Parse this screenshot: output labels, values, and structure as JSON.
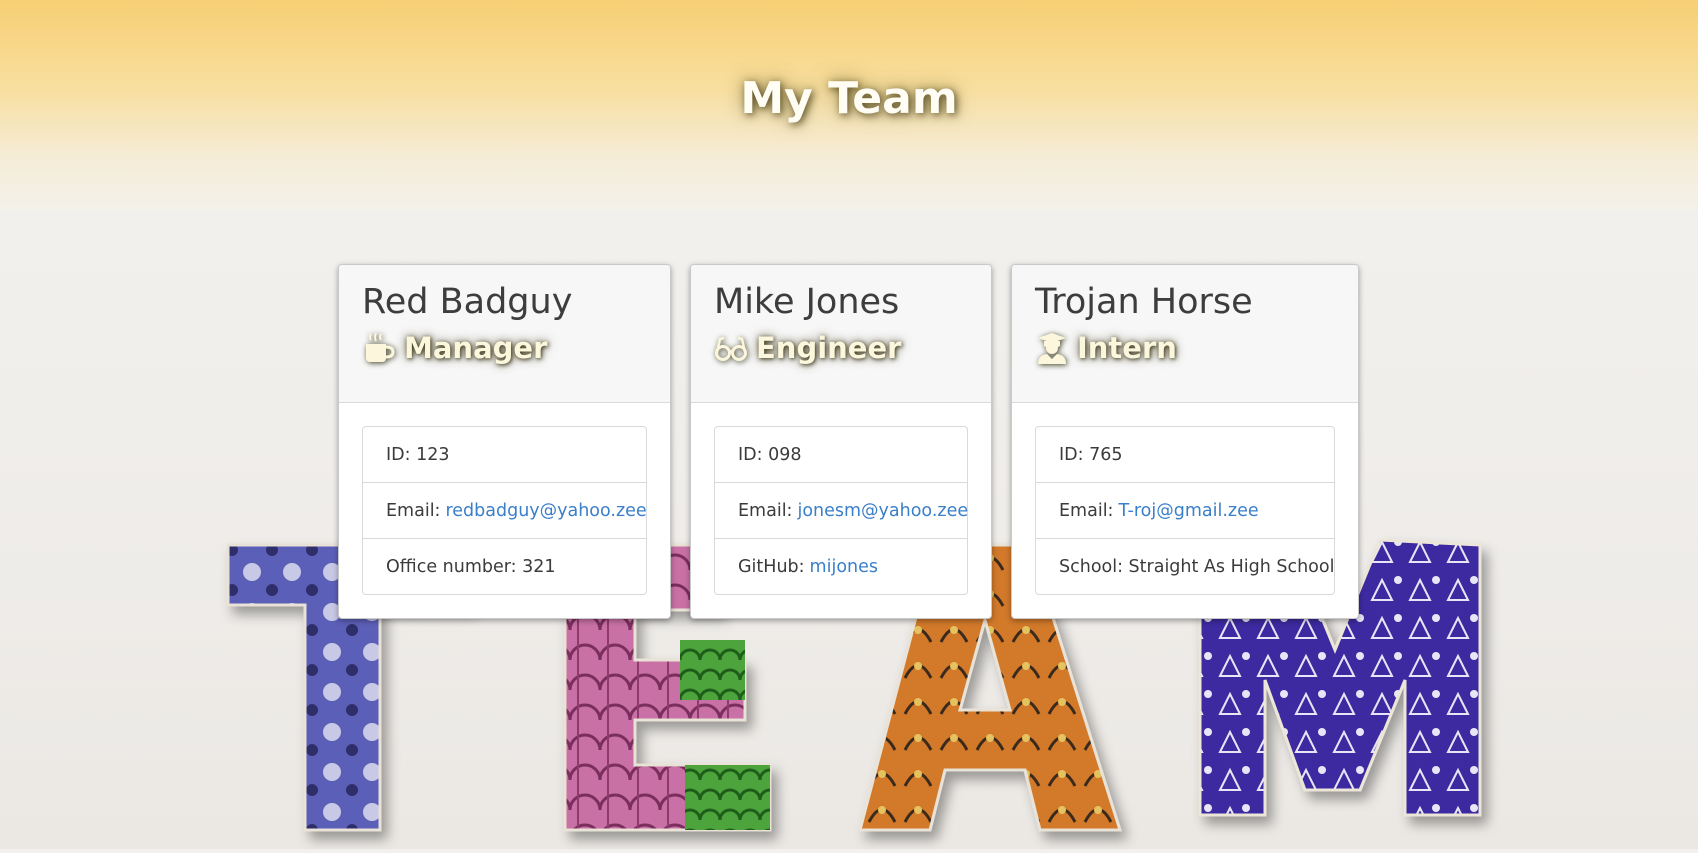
{
  "header": {
    "title": "My Team"
  },
  "team": [
    {
      "name": "Red Badguy",
      "role": "Manager",
      "role_icon": "coffee-mug-icon",
      "id": "ID: 123",
      "email_label": "Email:",
      "email": "redbadguy@yahoo.zee",
      "extra_label": "Office number: 321",
      "extra_value": ""
    },
    {
      "name": "Mike Jones",
      "role": "Engineer",
      "role_icon": "glasses-icon",
      "id": "ID: 098",
      "email_label": "Email:",
      "email": "jonesm@yahoo.zee",
      "extra_label": "GitHub:",
      "extra_value": "mijones"
    },
    {
      "name": "Trojan Horse",
      "role": "Intern",
      "role_icon": "graduate-icon",
      "id": "ID: 765",
      "email_label": "Email:",
      "email": "T-roj@gmail.zee",
      "extra_label": "School: Straight As High School",
      "extra_value": ""
    }
  ],
  "colors": {
    "header_top": "#f7cf75",
    "link": "#3a7fc9",
    "role_text": "#fbf6dc"
  }
}
